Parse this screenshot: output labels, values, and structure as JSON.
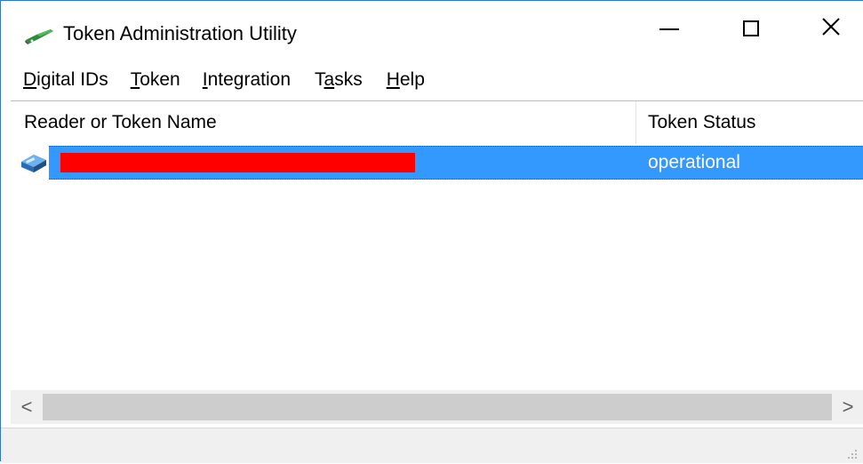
{
  "window": {
    "title": "Token Administration Utility",
    "icon": "token-pen-icon",
    "controls": [
      "minimize-icon",
      "maximize-icon",
      "close-icon"
    ]
  },
  "menu": {
    "items": [
      {
        "label_pre": "",
        "hotkey": "D",
        "label_post": "igital IDs"
      },
      {
        "label_pre": "",
        "hotkey": "T",
        "label_post": "oken"
      },
      {
        "label_pre": "",
        "hotkey": "I",
        "label_post": "ntegration"
      },
      {
        "label_pre": "T",
        "hotkey": "a",
        "label_post": "sks"
      },
      {
        "label_pre": "",
        "hotkey": "H",
        "label_post": "elp"
      }
    ]
  },
  "list": {
    "columns": [
      "Reader or Token Name",
      "Token Status"
    ],
    "rows": [
      {
        "icon": "token-reader-icon",
        "name": "",
        "name_redacted": true,
        "status": "operational",
        "selected": true
      }
    ]
  },
  "scrollbar": {
    "left_arrow": "<",
    "right_arrow": ">"
  },
  "colors": {
    "selection": "#3399ff",
    "redaction": "#ff0000",
    "window_border": "#2b78d4"
  }
}
